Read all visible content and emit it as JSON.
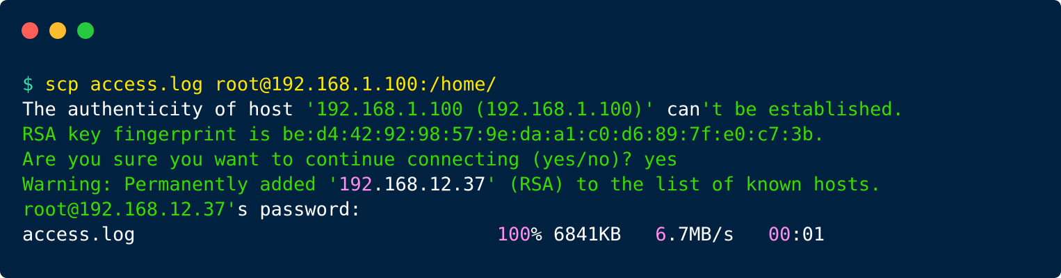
{
  "window": {
    "background": "#002240",
    "controls": [
      {
        "name": "close",
        "color": "#FF5F57"
      },
      {
        "name": "minimize",
        "color": "#FEBC2E"
      },
      {
        "name": "zoom",
        "color": "#28C840"
      }
    ]
  },
  "colors": {
    "prompt": "#3AD9A9",
    "command": "#FFE500",
    "white": "#FFFFFF",
    "green": "#3AD900",
    "pink": "#FF8DEE"
  },
  "terminal": {
    "lines": [
      [
        {
          "text": "$ ",
          "color": "prompt"
        },
        {
          "text": "scp access.log root@192.168.1.100:/home/",
          "color": "command"
        }
      ],
      [
        {
          "text": "The authenticity of host ",
          "color": "white"
        },
        {
          "text": "'192.168.1.100 (192.168.1.100)'",
          "color": "green"
        },
        {
          "text": " can",
          "color": "white"
        },
        {
          "text": "'t be established.",
          "color": "green"
        }
      ],
      [
        {
          "text": "RSA key fingerprint is be:d4:42:92:98:57:9e:da:a1:c0:d6:89:7f:e0:c7:3b.",
          "color": "green"
        }
      ],
      [
        {
          "text": "Are you sure you want to continue connecting (yes/no)? yes",
          "color": "green"
        }
      ],
      [
        {
          "text": "Warning: Permanently added '",
          "color": "green"
        },
        {
          "text": "192",
          "color": "pink"
        },
        {
          "text": ".168.12.37",
          "color": "white"
        },
        {
          "text": "' (RSA) to the list of known hosts.",
          "color": "green"
        }
      ],
      [
        {
          "text": "root@192.168.12.37'",
          "color": "green"
        },
        {
          "text": "s password:",
          "color": "white"
        }
      ],
      [
        {
          "text": "access.log                                ",
          "color": "white"
        },
        {
          "text": "100",
          "color": "pink"
        },
        {
          "text": "% 6841KB   ",
          "color": "white"
        },
        {
          "text": "6",
          "color": "pink"
        },
        {
          "text": ".7MB/s   ",
          "color": "white"
        },
        {
          "text": "00",
          "color": "pink"
        },
        {
          "text": ":01",
          "color": "white"
        }
      ]
    ]
  }
}
